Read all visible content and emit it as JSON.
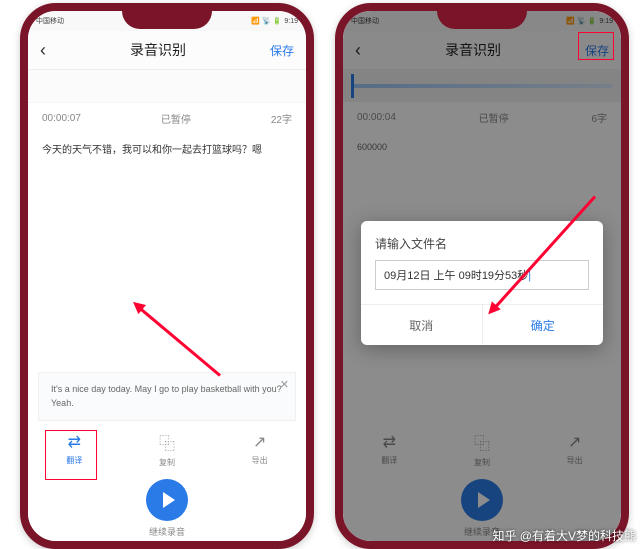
{
  "status_time": "9:19",
  "status_left": "中国移动",
  "header": {
    "title": "录音识别",
    "save": "保存"
  },
  "phone1": {
    "time": "00:00:07",
    "state": "已暂停",
    "count": "22字",
    "transcript": "今天的天气不错，我可以和你一起去打篮球吗？嗯",
    "translation": "It's a nice day today. May I go to play basketball with you? Yeah."
  },
  "phone2": {
    "time": "00:00:04",
    "state": "已暂停",
    "count": "6字",
    "msg": "600000"
  },
  "actions": {
    "translate": "翻译",
    "copy": "复制",
    "export": "导出"
  },
  "continue_label": "继续录音",
  "dialog": {
    "title": "请输入文件名",
    "value": "09月12日 上午 09时19分53秒",
    "cancel": "取消",
    "ok": "确定"
  },
  "watermark": "知乎 @有着大V梦的科技熊"
}
